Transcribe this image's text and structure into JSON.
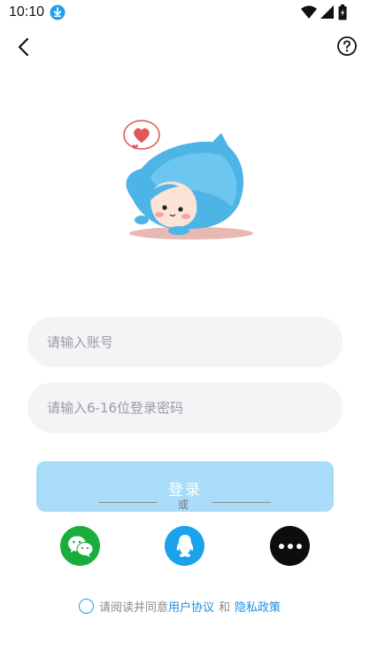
{
  "status_bar": {
    "time": "10:10",
    "download_icon": "download-icon",
    "icons": [
      "wifi-icon",
      "signal-icon",
      "battery-icon"
    ]
  },
  "header": {
    "back_icon": "back-arrow-icon",
    "help_icon": "help-icon"
  },
  "form": {
    "account_placeholder": "请输入账号",
    "password_placeholder": "请输入6-16位登录密码",
    "login_label": "登录"
  },
  "divider": {
    "text": "或"
  },
  "social_login": [
    {
      "name": "wechat",
      "icon": "wechat-icon",
      "color": "#1aad3c"
    },
    {
      "name": "qq",
      "icon": "qq-penguin-icon",
      "color": "#1aa2ec"
    },
    {
      "name": "more",
      "icon": "more-dots-icon",
      "color": "#0d0d0d"
    }
  ],
  "agreement": {
    "prefix": "请阅读并同意",
    "user_agreement": "用户协议",
    "and": "和",
    "privacy_policy": "隐私政策"
  },
  "colors": {
    "accent": "#1aa2ec",
    "login_button_disabled": "#a9dcf8",
    "input_bg": "#f3f4f6"
  }
}
